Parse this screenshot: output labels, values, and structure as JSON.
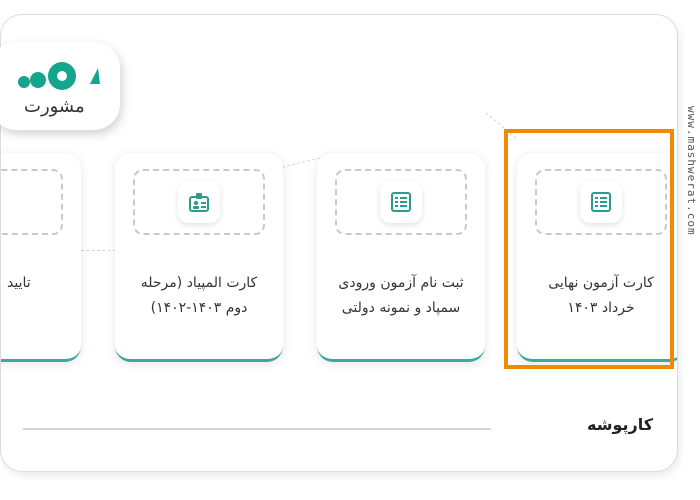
{
  "watermark": "www.mashwerat.com",
  "logo": {
    "text": "مشورت"
  },
  "cards": [
    {
      "label_line1": "کارت آزمون نهایی",
      "label_line2": "خرداد ۱۴۰۳",
      "icon": "list-icon"
    },
    {
      "label_line1": "ثبت نام آزمون ورودی",
      "label_line2": "سمپاد و نمونه دولتی",
      "icon": "list-icon"
    },
    {
      "label_line1": "کارت المپیاد (مرحله",
      "label_line2": "دوم ۱۴۰۳-۱۴۰۲)",
      "icon": "id-badge-icon"
    },
    {
      "label_line1": "تایید",
      "label_line2": "",
      "icon": ""
    }
  ],
  "section": {
    "title": "کارپوشه"
  },
  "colors": {
    "accent": "#3aa89a",
    "highlight": "#f08a00",
    "logo": "#13a58e"
  }
}
